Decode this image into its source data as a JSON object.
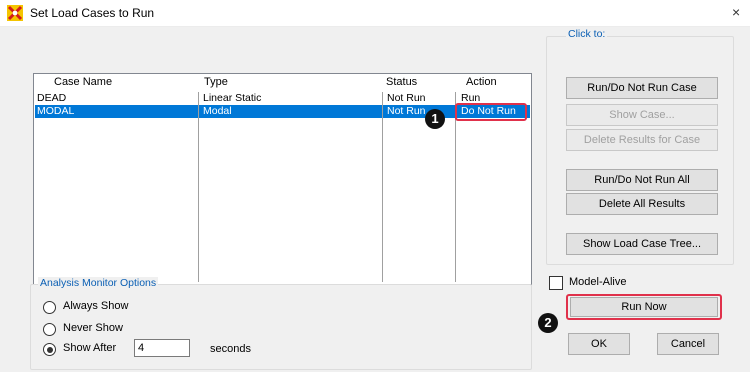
{
  "window": {
    "title": "Set Load Cases to Run"
  },
  "list": {
    "headers": {
      "name": "Case Name",
      "type": "Type",
      "status": "Status",
      "action": "Action"
    },
    "rows": [
      {
        "name": "DEAD",
        "type": "Linear Static",
        "status": "Not Run",
        "action": "Run"
      },
      {
        "name": "MODAL",
        "type": "Modal",
        "status": "Not Run",
        "action": "Do Not Run"
      }
    ]
  },
  "click_to": {
    "title": "Click to:",
    "buttons": [
      "Run/Do Not Run Case",
      "Show Case...",
      "Delete Results for Case",
      "Run/Do Not Run All",
      "Delete All Results",
      "Show Load Case Tree..."
    ]
  },
  "monitor": {
    "title": "Analysis Monitor Options",
    "always": "Always Show",
    "never": "Never Show",
    "after": "Show After",
    "seconds_value": "4",
    "seconds_label": "seconds",
    "selected": "after"
  },
  "model_alive_label": "Model-Alive",
  "run_now": "Run Now",
  "ok": "OK",
  "cancel": "Cancel",
  "callouts": {
    "one": "1",
    "two": "2"
  },
  "colors": {
    "selection": "#0078d7",
    "highlight": "#e0314b",
    "group_title": "#0a5fb4"
  }
}
